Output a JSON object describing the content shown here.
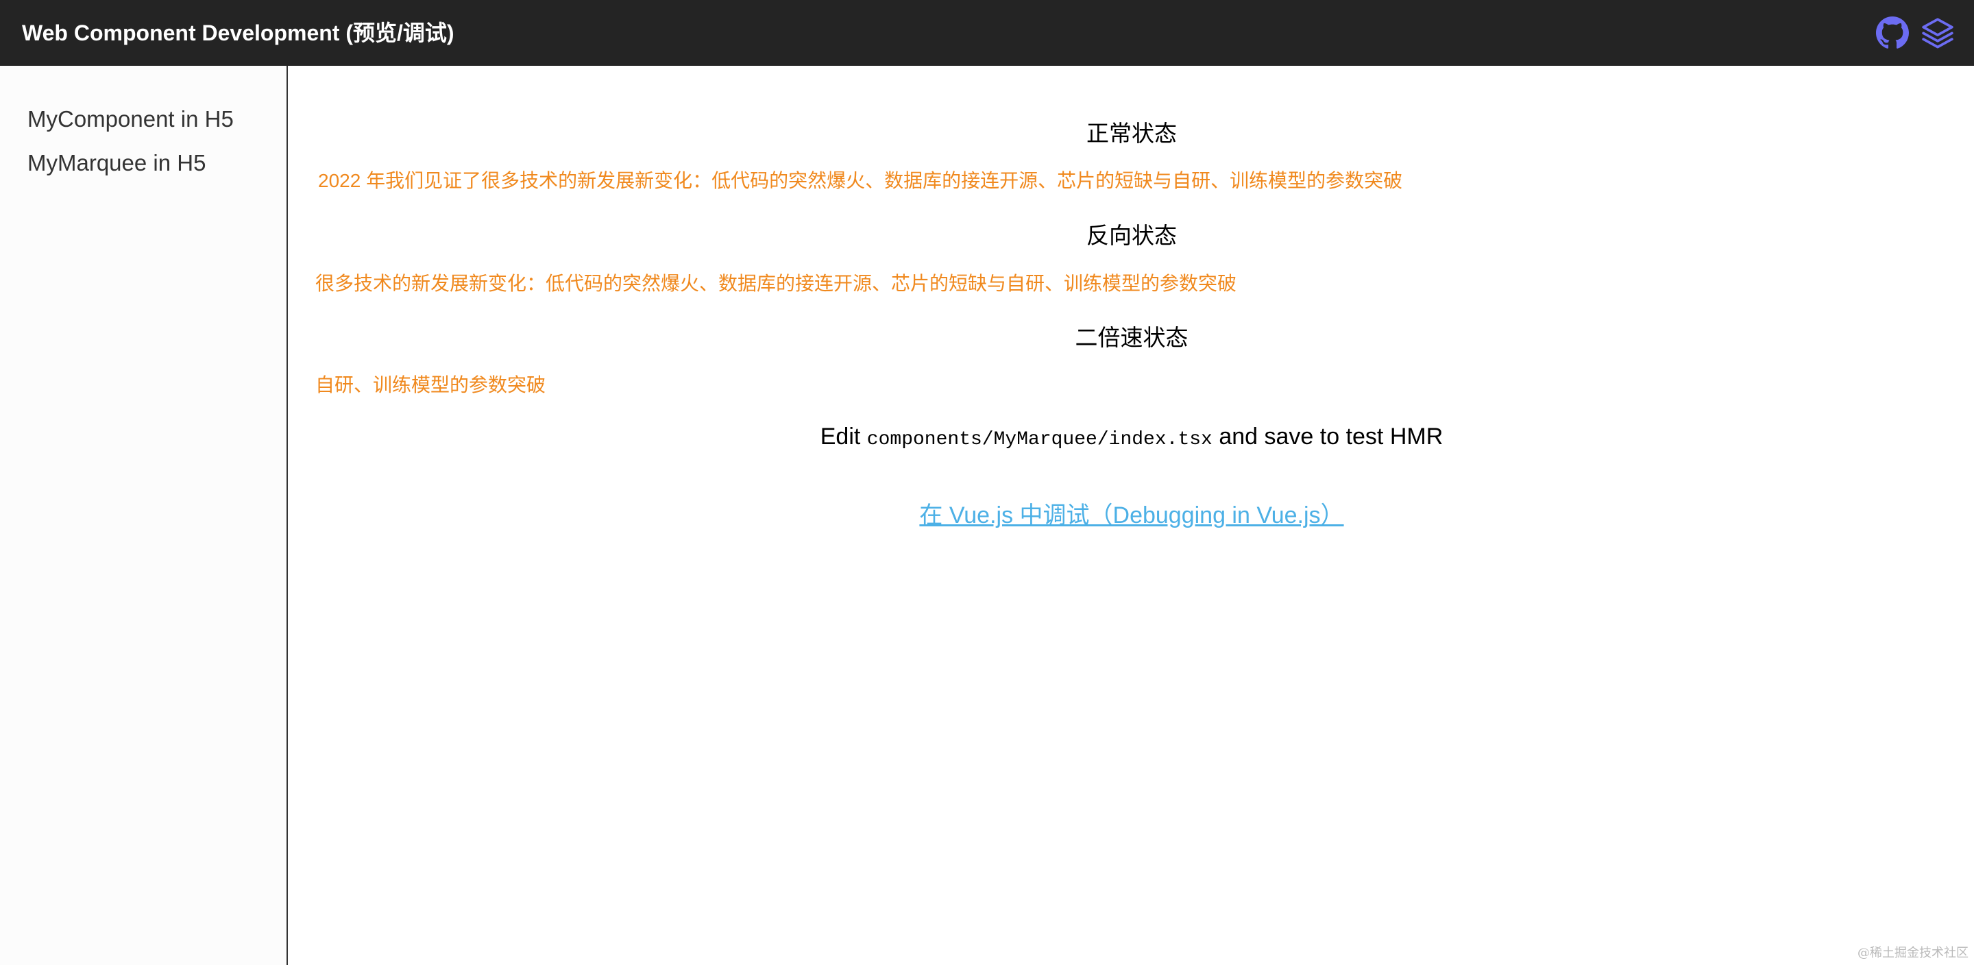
{
  "header": {
    "title": "Web Component Development (预览/调试)",
    "icons": [
      "github-icon",
      "layers-icon"
    ],
    "icon_color": "#6c6cf2",
    "background": "#242424"
  },
  "sidebar": {
    "items": [
      {
        "label": "MyComponent in H5"
      },
      {
        "label": "MyMarquee in H5"
      }
    ]
  },
  "main": {
    "sections": [
      {
        "heading": "正常状态",
        "marquee_text": "2022 年我们见证了很多技术的新发展新变化：低代码的突然爆火、数据库的接连开源、芯片的短缺与自研、训练模型的参数突破"
      },
      {
        "heading": "反向状态",
        "marquee_text": "很多技术的新发展新变化：低代码的突然爆火、数据库的接连开源、芯片的短缺与自研、训练模型的参数突破"
      },
      {
        "heading": "二倍速状态",
        "marquee_text": "自研、训练模型的参数突破"
      }
    ],
    "marquee_color": "#f0891e",
    "hmr": {
      "prefix": "Edit",
      "path": "components/MyMarquee/index.tsx",
      "suffix": "and save to test HMR"
    },
    "vue_link": "在 Vue.js 中调试（Debugging in Vue.js）",
    "link_color": "#4cb0e6"
  },
  "watermark": "@稀土掘金技术社区"
}
